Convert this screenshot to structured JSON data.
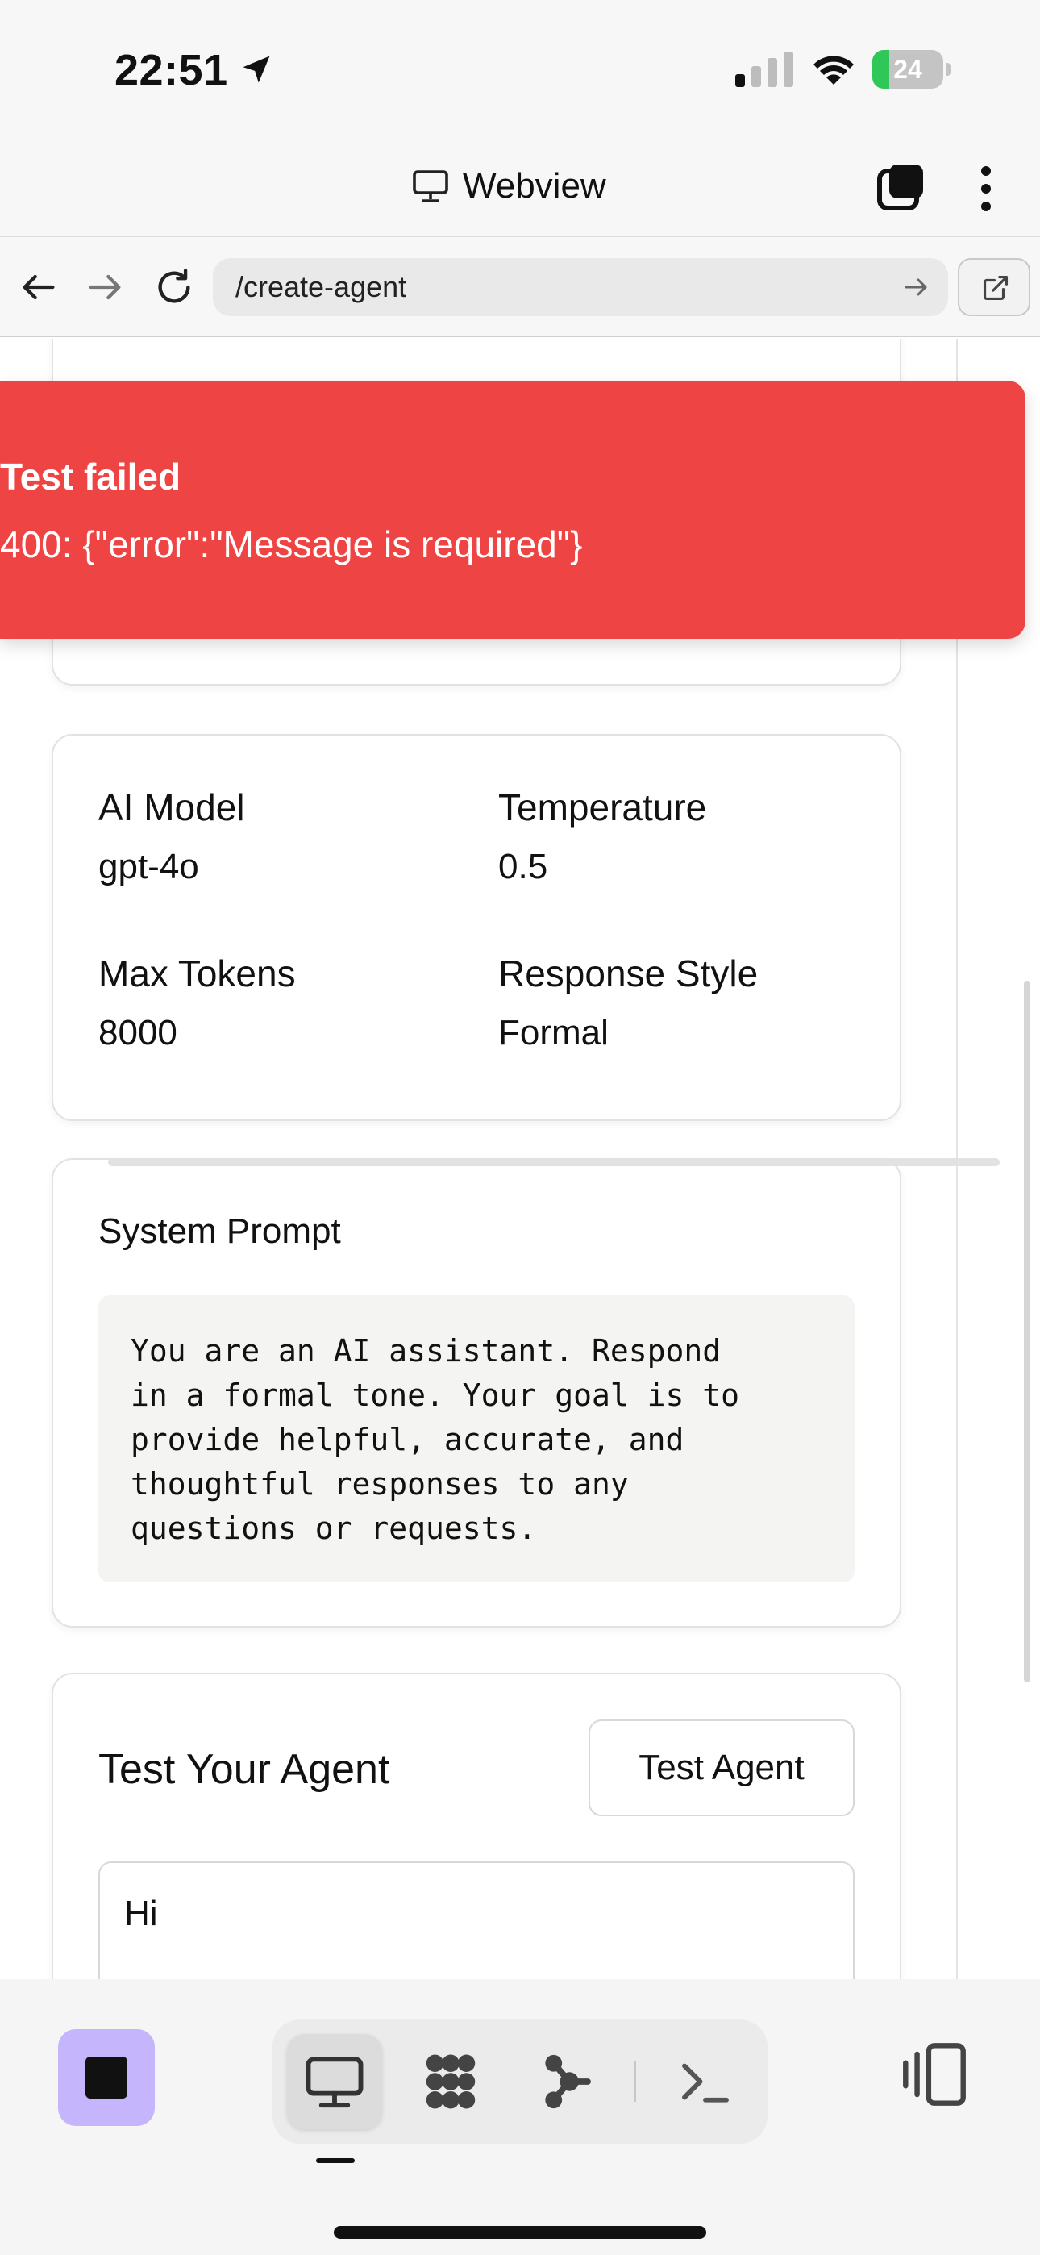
{
  "status_bar": {
    "time": "22:51",
    "battery_level": "24",
    "battery_fraction": 0.24,
    "battery_color": "#30c759"
  },
  "app_header": {
    "title": "Webview",
    "title_icon": "monitor-icon",
    "tabs_icon": "tabs-icon",
    "more_icon": "more-vertical-icon"
  },
  "url_bar": {
    "url": "/create-agent",
    "back_icon": "arrow-left-icon",
    "forward_icon": "arrow-right-icon",
    "reload_icon": "reload-icon",
    "go_icon": "arrow-right-icon",
    "open_external_icon": "external-link-icon"
  },
  "toast": {
    "title": "Test failed",
    "message": "400: {\"error\":\"Message is required\"}",
    "color": "#ef4444"
  },
  "model_card": {
    "ai_model_label": "AI Model",
    "ai_model_value": "gpt-4o",
    "temperature_label": "Temperature",
    "temperature_value": "0.5",
    "max_tokens_label": "Max Tokens",
    "max_tokens_value": "8000",
    "response_style_label": "Response Style",
    "response_style_value": "Formal"
  },
  "prompt_card": {
    "title": "System Prompt",
    "text": "You are an AI assistant. Respond\nin a formal tone. Your goal is to\nprovide helpful, accurate, and\nthoughtful responses to any\nquestions or requests."
  },
  "test_card": {
    "title": "Test Your Agent",
    "button_label": "Test Agent",
    "input_value": "Hi"
  },
  "bottom_bar": {
    "stop_color": "#c4b5fd",
    "items": [
      {
        "icon": "monitor-icon",
        "active": true
      },
      {
        "icon": "grid-dots-icon",
        "active": false
      },
      {
        "icon": "nodes-icon",
        "active": false
      },
      {
        "icon": "terminal-icon",
        "active": false
      }
    ],
    "panel_icon": "panel-toggle-icon"
  }
}
